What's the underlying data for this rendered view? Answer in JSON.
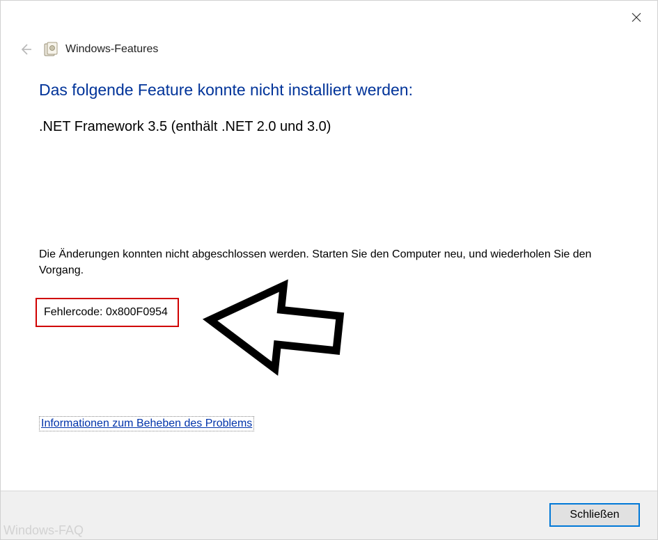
{
  "header": {
    "title": "Windows-Features"
  },
  "content": {
    "heading": "Das folgende Feature konnte nicht installiert werden:",
    "feature": ".NET Framework 3.5 (enthält .NET 2.0 und 3.0)",
    "body": "Die Änderungen konnten nicht abgeschlossen werden. Starten Sie den Computer neu, und wiederholen Sie den Vorgang.",
    "error_label": "Fehlercode:",
    "error_code": "0x800F0954",
    "help_link": "Informationen zum Beheben des Problems"
  },
  "footer": {
    "close_label": "Schließen"
  },
  "watermark": "Windows-FAQ"
}
